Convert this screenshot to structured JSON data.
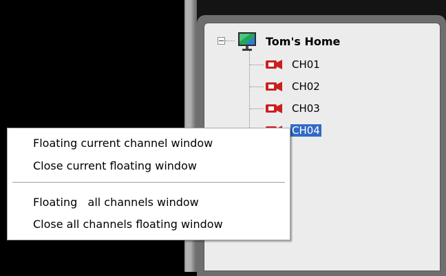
{
  "tree": {
    "root_label": "Tom's Home",
    "root_icon": "monitor-icon",
    "expander_symbol": "minus",
    "channels": [
      {
        "label": "CH01",
        "icon": "camera-icon",
        "selected": false
      },
      {
        "label": "CH02",
        "icon": "camera-icon",
        "selected": false
      },
      {
        "label": "CH03",
        "icon": "camera-icon",
        "selected": false
      },
      {
        "label": "CH04",
        "icon": "camera-icon",
        "selected": true
      }
    ]
  },
  "context_menu": {
    "items": [
      "Floating current channel window",
      "Close current floating window",
      "Floating   all channels window",
      "Close all channels floating window"
    ]
  },
  "colors": {
    "camera": "#cc1f1f",
    "selection": "#316ac5",
    "panel_background": "#ececec"
  }
}
